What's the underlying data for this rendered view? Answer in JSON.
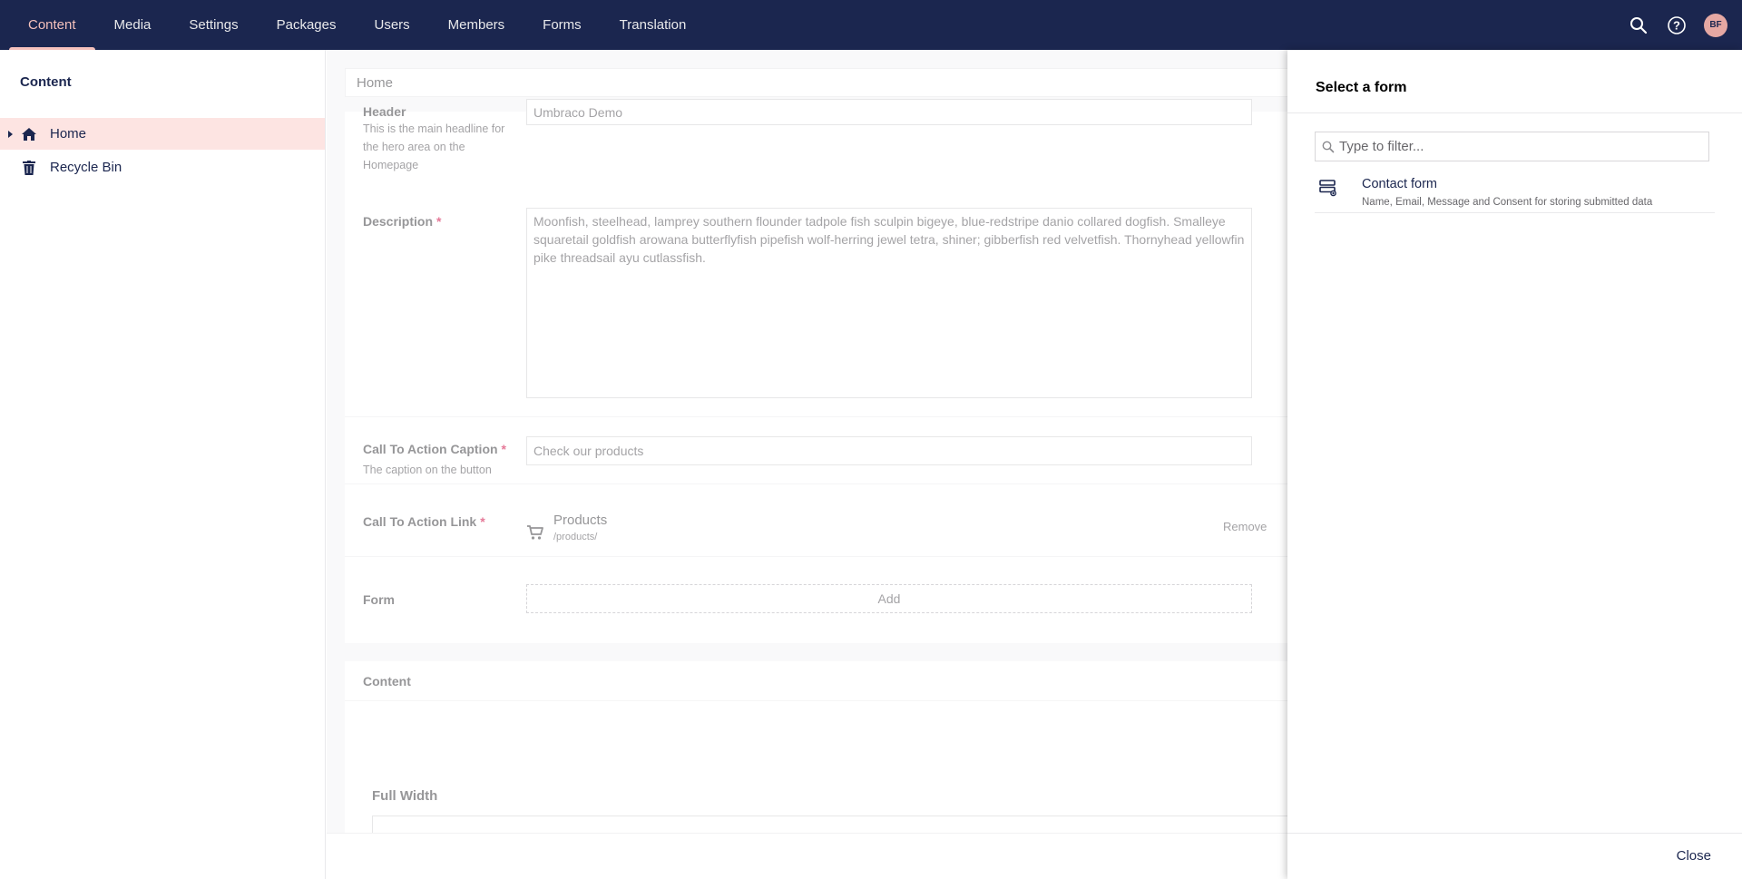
{
  "nav": {
    "items": [
      {
        "label": "Content",
        "active": true
      },
      {
        "label": "Media"
      },
      {
        "label": "Settings"
      },
      {
        "label": "Packages"
      },
      {
        "label": "Users"
      },
      {
        "label": "Members"
      },
      {
        "label": "Forms"
      },
      {
        "label": "Translation"
      }
    ],
    "active_color": "#f5c1bc",
    "bar_color": "#1b264f"
  },
  "user": {
    "initials": "BF"
  },
  "sidebar": {
    "title": "Content",
    "items": [
      {
        "label": "Home",
        "icon": "home-icon",
        "selected": true
      },
      {
        "label": "Recycle Bin",
        "icon": "trash-icon"
      }
    ]
  },
  "editor": {
    "breadcrumb": "Home",
    "header": {
      "label": "Header",
      "description": "This is the main headline for the hero area on the Homepage",
      "value": "Umbraco Demo"
    },
    "description": {
      "label": "Description",
      "required_mark": "*",
      "value": "Moonfish, steelhead, lamprey southern flounder tadpole fish sculpin bigeye, blue-redstripe danio collared dogfish. Smalleye squaretail goldfish arowana butterflyfish pipefish wolf-herring jewel tetra, shiner; gibberfish red velvetfish. Thornyhead yellowfin pike threadsail ayu cutlassfish."
    },
    "cta_caption": {
      "label": "Call To Action Caption",
      "required_mark": "*",
      "description": "The caption on the button",
      "value": "Check our products"
    },
    "cta_link": {
      "label": "Call To Action Link",
      "required_mark": "*",
      "link_name": "Products",
      "link_url": "/products/",
      "remove_label": "Remove"
    },
    "form": {
      "label": "Form",
      "add_label": "Add"
    },
    "content_group": {
      "title": "Content",
      "section": "Full Width"
    }
  },
  "drawer": {
    "title": "Select a form",
    "filter_placeholder": "Type to filter...",
    "forms": [
      {
        "name": "Contact form",
        "description": "Name, Email, Message and Consent for storing submitted data"
      }
    ],
    "close_label": "Close"
  }
}
